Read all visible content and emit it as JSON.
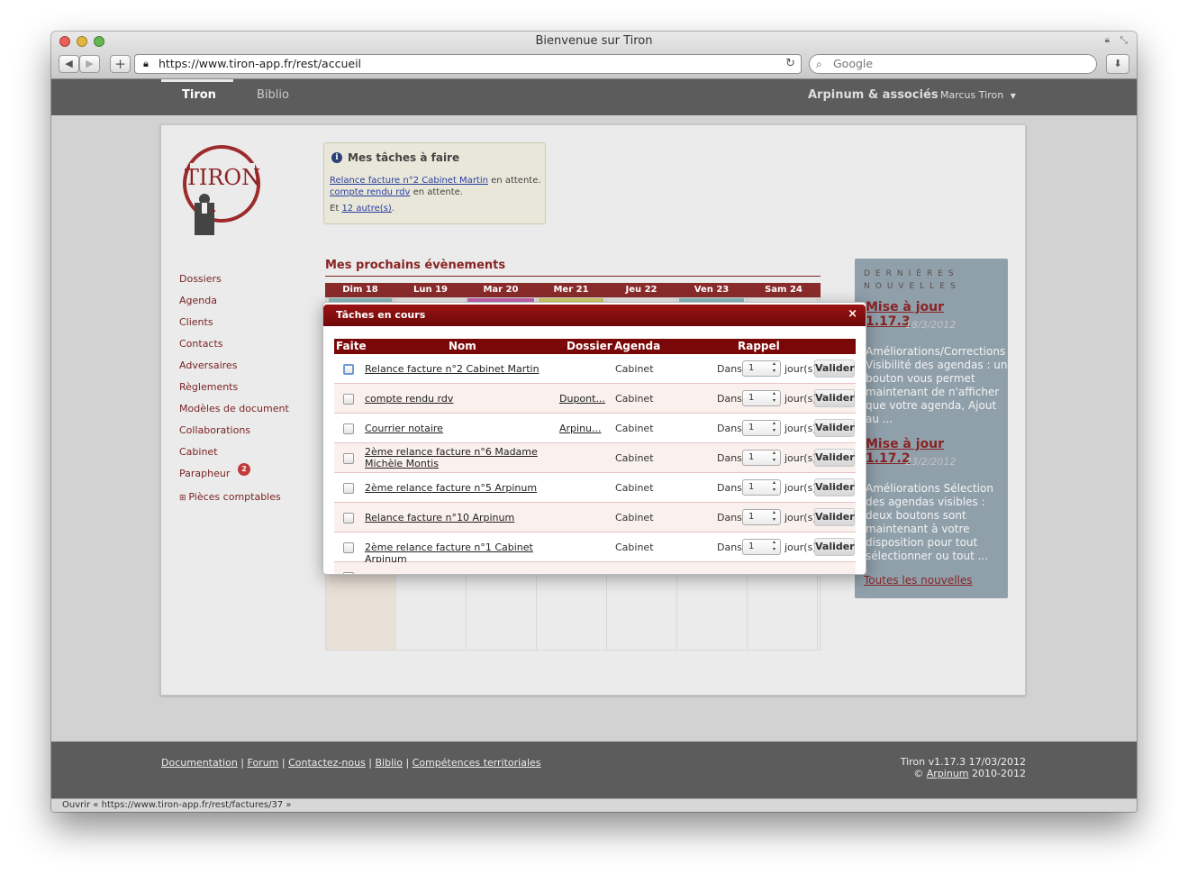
{
  "window": {
    "title": "Bienvenue sur Tiron"
  },
  "browser": {
    "url": "https://www.tiron-app.fr/rest/accueil",
    "search_placeholder": "Google"
  },
  "appbar": {
    "tabs": [
      "Tiron",
      "Biblio"
    ],
    "firm": "Arpinum & associés",
    "user": "Marcus Tiron"
  },
  "logo": {
    "text": "TIRON"
  },
  "sidebar": {
    "items": [
      "Dossiers",
      "Agenda",
      "Clients",
      "Contacts",
      "Adversaires",
      "Règlements",
      "Modèles de document",
      "Collaborations",
      "Cabinet",
      "Parapheur"
    ],
    "parapheur_badge": "2",
    "expandable": "Pièces comptables"
  },
  "tasks_box": {
    "title": "Mes tâches à faire",
    "item1_link": "Relance facture n°2 Cabinet Martin",
    "item1_status": "en attente.",
    "item2_link": "compte rendu rdv",
    "item2_status": "en attente.",
    "more_prefix": "Et",
    "more_link": "12 autre(s)",
    "more_suffix": "."
  },
  "events": {
    "title": "Mes prochains évènements",
    "days": [
      "Dim 18",
      "Lun 19",
      "Mar 20",
      "Mer 21",
      "Jeu 22",
      "Ven 23",
      "Sam 24"
    ]
  },
  "news": {
    "heading_line1": "DERNIÈRES",
    "heading_line2": "NOUVELLES",
    "items": [
      {
        "title_line1": "Mise à jour",
        "title_line2": "1.17.3",
        "date": "18/3/2012",
        "text": "Améliorations/Corrections Visibilité des agendas : un bouton vous permet maintenant de n'afficher que votre agenda, Ajout au ..."
      },
      {
        "title_line1": "Mise à jour",
        "title_line2": "1.17.2",
        "date": "23/2/2012",
        "text": "Améliorations Sélection des agendas visibles : deux boutons sont maintenant à votre disposition pour tout sélectionner ou tout ..."
      }
    ],
    "all_link": "Toutes les nouvelles"
  },
  "modal": {
    "title": "Tâches en cours",
    "close": "×",
    "columns": {
      "done": "Faite",
      "name": "Nom",
      "folder": "Dossier",
      "agenda": "Agenda",
      "reminder": "Rappel"
    },
    "dans": "Dans",
    "jours": "jour(s)",
    "valider": "Valider",
    "rows": [
      {
        "name": "Relance facture n°2 Cabinet Martin",
        "folder": "",
        "agenda": "Cabinet",
        "days": "1"
      },
      {
        "name": "compte rendu rdv",
        "folder": "Dupont...",
        "agenda": "Cabinet",
        "days": "1"
      },
      {
        "name": "Courrier notaire",
        "folder": "Arpinu...",
        "agenda": "Cabinet",
        "days": "1"
      },
      {
        "name": "2ème relance facture n°6 Madame Michèle Montis",
        "folder": "",
        "agenda": "Cabinet",
        "days": "1"
      },
      {
        "name": "2ème relance facture n°5 Arpinum",
        "folder": "",
        "agenda": "Cabinet",
        "days": "1"
      },
      {
        "name": "Relance facture n°10 Arpinum",
        "folder": "",
        "agenda": "Cabinet",
        "days": "1"
      },
      {
        "name": "2ème relance facture n°1 Cabinet Arpinum",
        "folder": "",
        "agenda": "Cabinet",
        "days": "1"
      }
    ]
  },
  "footer": {
    "links": [
      "Documentation",
      "Forum",
      "Contactez-nous",
      "Biblio",
      "Compétences territoriales"
    ],
    "version": "Tiron v1.17.3 17/03/2012",
    "copyright_prefix": "©",
    "copyright_link": "Arpinum",
    "copyright_years": "2010-2012"
  },
  "statusbar": {
    "text": "Ouvrir « https://www.tiron-app.fr/rest/factures/37 »"
  },
  "colors": {
    "accent": "#8a2323",
    "modal_header": "#7a0808",
    "appbar": "#5c5c5c",
    "news_bg": "#8fa0ab"
  }
}
